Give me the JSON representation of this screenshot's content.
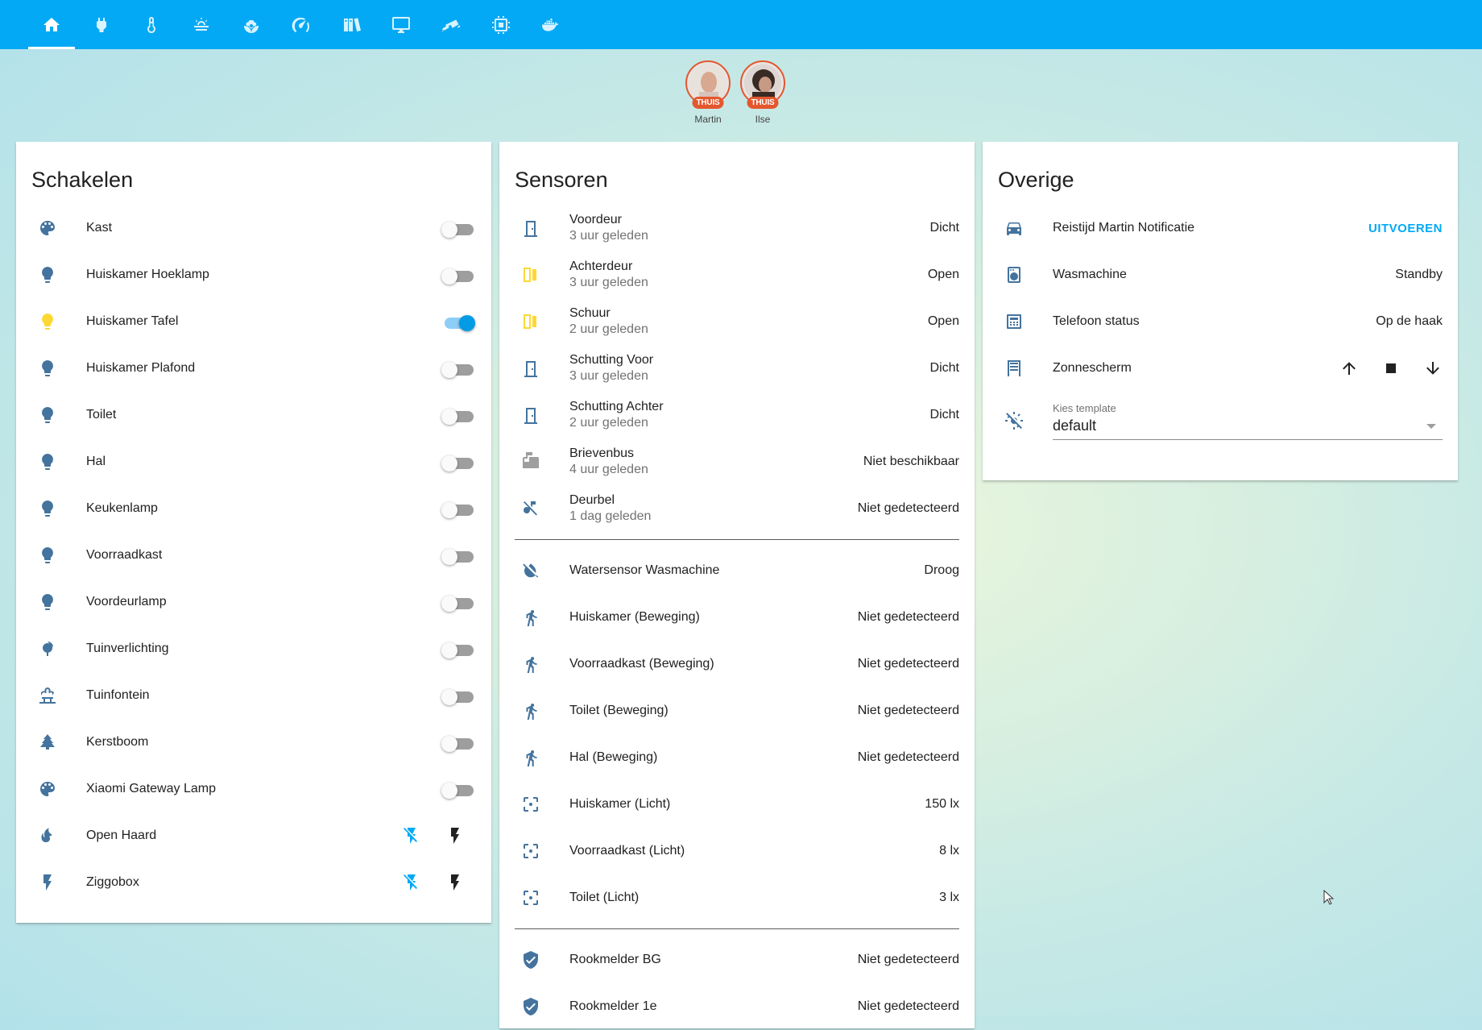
{
  "topbar": {
    "tabs": [
      {
        "icon": "home-icon",
        "active": true
      },
      {
        "icon": "power-plug-icon"
      },
      {
        "icon": "thermometer-icon"
      },
      {
        "icon": "weather-partly-cloudy-icon"
      },
      {
        "icon": "flower-icon"
      },
      {
        "icon": "speedometer-icon"
      },
      {
        "icon": "library-books-icon"
      },
      {
        "icon": "monitor-icon"
      },
      {
        "icon": "cctv-icon"
      },
      {
        "icon": "chip-icon"
      },
      {
        "icon": "docker-icon"
      }
    ],
    "accent": "#03a9f4"
  },
  "badges": [
    {
      "name": "Martin",
      "state": "THUIS"
    },
    {
      "name": "Ilse",
      "state": "THUIS"
    }
  ],
  "schakelen": {
    "title": "Schakelen",
    "items": [
      {
        "name": "Kast",
        "icon": "palette-icon",
        "state": "off"
      },
      {
        "name": "Huiskamer Hoeklamp",
        "icon": "lightbulb-icon",
        "state": "off"
      },
      {
        "name": "Huiskamer Tafel",
        "icon": "lightbulb-icon",
        "state": "on"
      },
      {
        "name": "Huiskamer Plafond",
        "icon": "lightbulb-icon",
        "state": "off"
      },
      {
        "name": "Toilet",
        "icon": "lightbulb-icon",
        "state": "off"
      },
      {
        "name": "Hal",
        "icon": "lightbulb-icon",
        "state": "off"
      },
      {
        "name": "Keukenlamp",
        "icon": "lightbulb-icon",
        "state": "off"
      },
      {
        "name": "Voorraadkast",
        "icon": "lightbulb-icon",
        "state": "off"
      },
      {
        "name": "Voordeurlamp",
        "icon": "lightbulb-icon",
        "state": "off"
      },
      {
        "name": "Tuinverlichting",
        "icon": "tree-icon",
        "state": "off"
      },
      {
        "name": "Tuinfontein",
        "icon": "fountain-icon",
        "state": "off"
      },
      {
        "name": "Kerstboom",
        "icon": "pine-tree-icon",
        "state": "off"
      },
      {
        "name": "Xiaomi Gateway Lamp",
        "icon": "palette-icon",
        "state": "off"
      },
      {
        "name": "Open Haard",
        "icon": "fire-icon",
        "state": "buttons"
      },
      {
        "name": "Ziggobox",
        "icon": "flash-icon",
        "state": "buttons"
      }
    ]
  },
  "sensoren": {
    "title": "Sensoren",
    "group1": [
      {
        "name": "Voordeur",
        "time": "3 uur geleden",
        "value": "Dicht",
        "icon": "door-closed-icon"
      },
      {
        "name": "Achterdeur",
        "time": "3 uur geleden",
        "value": "Open",
        "icon": "door-open-icon"
      },
      {
        "name": "Schuur",
        "time": "2 uur geleden",
        "value": "Open",
        "icon": "door-open-icon"
      },
      {
        "name": "Schutting Voor",
        "time": "3 uur geleden",
        "value": "Dicht",
        "icon": "door-closed-icon"
      },
      {
        "name": "Schutting Achter",
        "time": "2 uur geleden",
        "value": "Dicht",
        "icon": "door-closed-icon"
      },
      {
        "name": "Brievenbus",
        "time": "4 uur geleden",
        "value": "Niet beschikbaar",
        "icon": "mailbox-icon"
      },
      {
        "name": "Deurbel",
        "time": "1 dag geleden",
        "value": "Niet gedetecteerd",
        "icon": "music-note-off-icon"
      }
    ],
    "group2": [
      {
        "name": "Watersensor Wasmachine",
        "value": "Droog",
        "icon": "water-off-icon"
      },
      {
        "name": "Huiskamer (Beweging)",
        "value": "Niet gedetecteerd",
        "icon": "walk-icon"
      },
      {
        "name": "Voorraadkast (Beweging)",
        "value": "Niet gedetecteerd",
        "icon": "walk-icon"
      },
      {
        "name": "Toilet (Beweging)",
        "value": "Niet gedetecteerd",
        "icon": "walk-icon"
      },
      {
        "name": "Hal (Beweging)",
        "value": "Niet gedetecteerd",
        "icon": "walk-icon"
      },
      {
        "name": "Huiskamer (Licht)",
        "value": "150 lx",
        "icon": "focus-icon"
      },
      {
        "name": "Voorraadkast (Licht)",
        "value": "8 lx",
        "icon": "focus-icon"
      },
      {
        "name": "Toilet (Licht)",
        "value": "3 lx",
        "icon": "focus-icon"
      }
    ],
    "group3": [
      {
        "name": "Rookmelder BG",
        "value": "Niet gedetecteerd",
        "icon": "shield-check-icon"
      },
      {
        "name": "Rookmelder 1e",
        "value": "Niet gedetecteerd",
        "icon": "shield-check-icon"
      }
    ]
  },
  "overige": {
    "title": "Overige",
    "script": {
      "name": "Reistijd Martin Notificatie",
      "action": "UITVOEREN"
    },
    "wasmachine": {
      "name": "Wasmachine",
      "value": "Standby"
    },
    "telefoon": {
      "name": "Telefoon status",
      "value": "Op de haak"
    },
    "zonnescherm": {
      "name": "Zonnescherm"
    },
    "select": {
      "label": "Kies template",
      "value": "default"
    }
  },
  "colors": {
    "icon": "#44739e",
    "on": "#fdd835",
    "toggle_on": "#039be5",
    "badge": "#e4572e"
  }
}
